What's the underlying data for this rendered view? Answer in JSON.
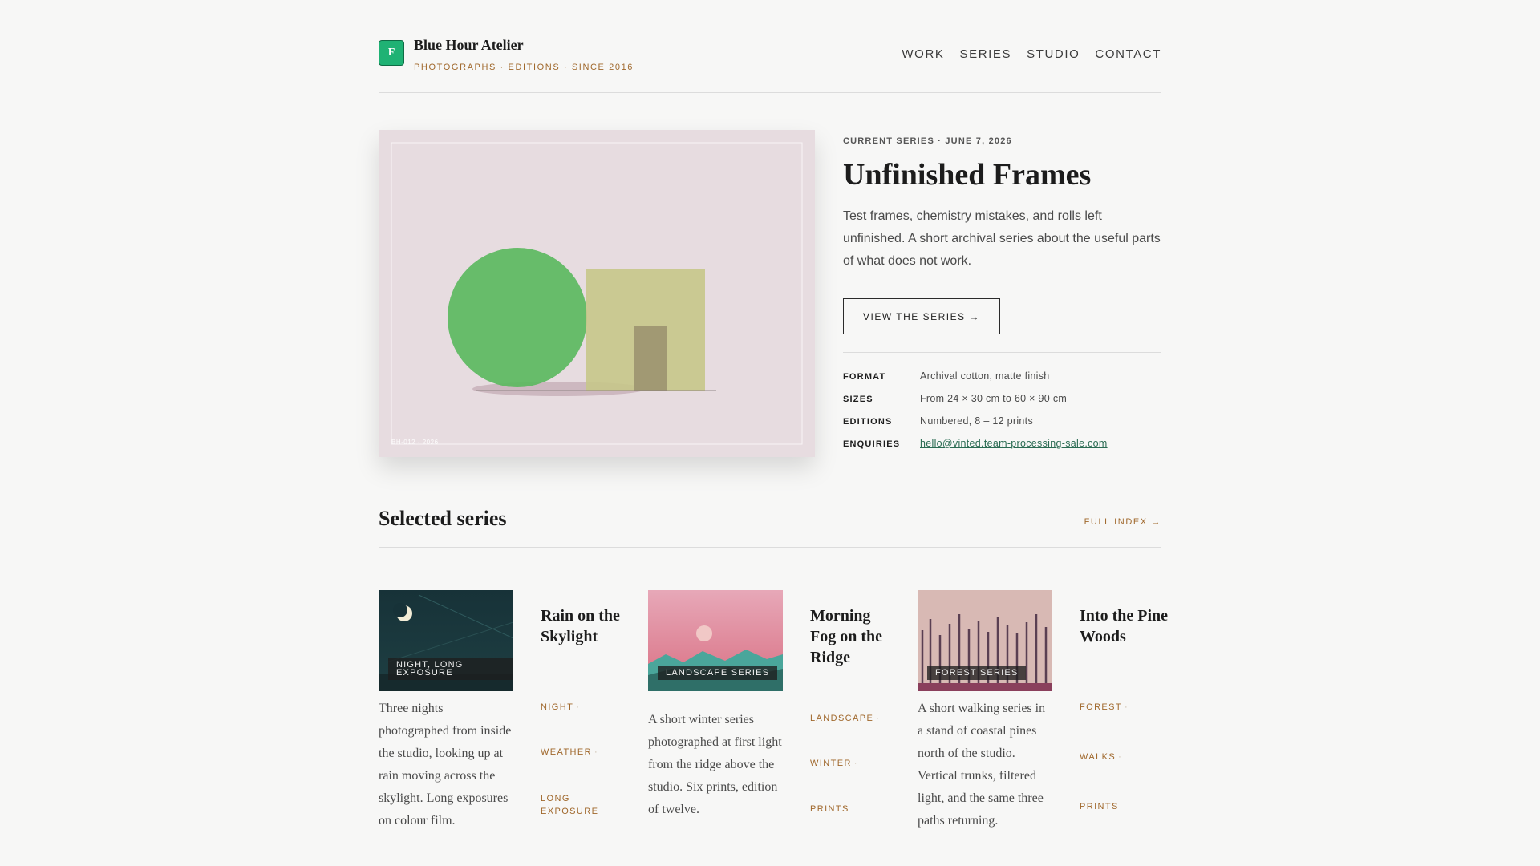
{
  "brand": {
    "initial": "F",
    "name": "Blue Hour Atelier",
    "tagline": "PHOTOGRAPHS · EDITIONS · SINCE 2016"
  },
  "nav": [
    "WORK",
    "SERIES",
    "STUDIO",
    "CONTACT"
  ],
  "hero": {
    "eyebrow": "CURRENT SERIES · JUNE 7, 2026",
    "title": "Unfinished Frames",
    "description": "Test frames, chemistry mistakes, and rolls left unfinished. A short archival series about the useful parts of what does not work.",
    "cta": "VIEW THE SERIES →",
    "image_caption": "BH-012 · 2026",
    "meta": [
      {
        "key": "FORMAT",
        "value": "Archival cotton, matte finish"
      },
      {
        "key": "SIZES",
        "value": "From 24 × 30 cm to 60 × 90 cm"
      },
      {
        "key": "EDITIONS",
        "value": "Numbered, 8 – 12 prints"
      },
      {
        "key": "ENQUIRIES",
        "value": "hello@vinted.team-processing-sale.com"
      }
    ]
  },
  "selected": {
    "title": "Selected series",
    "full_index": "FULL INDEX →",
    "cards": [
      {
        "image_label": "NIGHT, LONG EXPOSURE",
        "description": "Three nights photographed from inside the studio, looking up at rain moving across the skylight. Long exposures on colour film.",
        "title": "Rain on the Skylight",
        "tags": [
          "NIGHT",
          "WEATHER",
          "LONG EXPOSURE"
        ]
      },
      {
        "image_label": "LANDSCAPE SERIES",
        "description": "A short winter series photographed at first light from the ridge above the studio. Six prints, edition of twelve.",
        "title": "Morning Fog on the Ridge",
        "tags": [
          "LANDSCAPE",
          "WINTER",
          "PRINTS"
        ]
      },
      {
        "image_label": "FOREST SERIES",
        "description": "A short walking series in a stand of coastal pines north of the studio. Vertical trunks, filtered light, and the same three paths returning.",
        "title": "Into the Pine Woods",
        "tags": [
          "FOREST",
          "WALKS",
          "PRINTS"
        ]
      }
    ]
  },
  "colors": {
    "accent": "#a0682c",
    "brand_green": "#1fb274",
    "link": "#2a6b52",
    "background": "#f7f7f6"
  }
}
